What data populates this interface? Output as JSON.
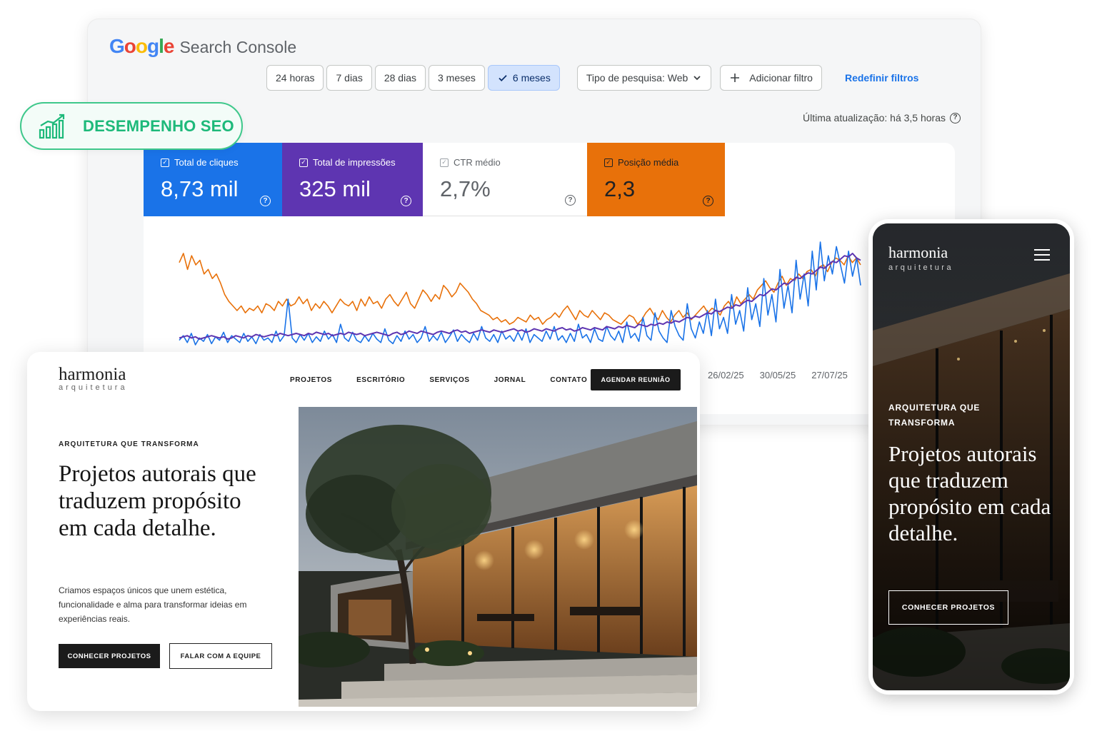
{
  "search_console": {
    "product_name": "Search Console",
    "google_letters": [
      {
        "char": "G",
        "color": "#4285F4"
      },
      {
        "char": "o",
        "color": "#EA4335"
      },
      {
        "char": "o",
        "color": "#FBBC05"
      },
      {
        "char": "g",
        "color": "#4285F4"
      },
      {
        "char": "l",
        "color": "#34A853"
      },
      {
        "char": "e",
        "color": "#EA4335"
      }
    ],
    "date_ranges": [
      "24 horas",
      "7 dias",
      "28 dias",
      "3 meses",
      "6 meses"
    ],
    "selected_range": "6 meses",
    "search_type": "Tipo de pesquisa: Web",
    "add_filter": "Adicionar filtro",
    "reset_filters": "Redefinir filtros",
    "last_update": "Última atualização: há 3,5 horas",
    "metrics": [
      {
        "label": "Total de cliques",
        "value": "8,73 mil",
        "color": "#1a73e8"
      },
      {
        "label": "Total de impressões",
        "value": "325 mil",
        "color": "#5e35b1"
      },
      {
        "label": "CTR médio",
        "value": "2,7%",
        "color": "#ffffff"
      },
      {
        "label": "Posição média",
        "value": "2,3",
        "color": "#e8710a"
      }
    ]
  },
  "chart_data": {
    "type": "line",
    "x_tick_labels": [
      "26/02/25",
      "30/05/25",
      "27/07/25"
    ],
    "grid": false,
    "legend": "none",
    "series": [
      {
        "color": "#e8710a",
        "values": [
          72,
          80,
          66,
          78,
          70,
          74,
          62,
          66,
          58,
          62,
          54,
          44,
          38,
          34,
          30,
          34,
          28,
          32,
          30,
          34,
          28,
          36,
          34,
          30,
          38,
          34,
          40,
          34,
          36,
          42,
          36,
          40,
          30,
          36,
          32,
          38,
          34,
          28,
          34,
          40,
          36,
          34,
          38,
          30,
          40,
          34,
          42,
          36,
          38,
          32,
          40,
          44,
          38,
          34,
          40,
          46,
          36,
          32,
          40,
          48,
          44,
          38,
          44,
          40,
          52,
          48,
          42,
          46,
          54,
          50,
          46,
          40,
          36,
          30,
          28,
          26,
          22,
          24,
          20,
          22,
          18,
          20,
          24,
          22,
          20,
          26,
          22,
          24,
          18,
          22,
          24,
          28,
          24,
          30,
          34,
          28,
          22,
          30,
          26,
          24,
          30,
          26,
          22,
          28,
          26,
          22,
          20,
          18,
          22,
          26,
          24,
          18,
          22,
          28,
          32,
          26,
          22,
          30,
          24,
          20,
          26,
          30,
          24,
          28,
          22,
          26,
          30,
          34,
          28,
          32,
          30,
          26,
          34,
          38,
          32,
          42,
          36,
          40,
          44,
          40,
          48,
          52,
          56,
          50,
          46,
          54,
          60,
          52,
          58,
          56,
          62,
          58,
          64,
          66,
          60,
          68,
          70,
          64,
          72,
          76,
          74,
          70,
          78,
          72,
          76,
          70
        ]
      },
      {
        "color": "#1a73e8",
        "values": [
          4,
          8,
          2,
          10,
          0,
          6,
          3,
          9,
          1,
          7,
          4,
          11,
          2,
          8,
          5,
          2,
          10,
          3,
          7,
          1,
          9,
          4,
          6,
          2,
          12,
          3,
          8,
          40,
          6,
          2,
          9,
          4,
          10,
          2,
          7,
          3,
          12,
          5,
          9,
          2,
          18,
          6,
          3,
          11,
          4,
          2,
          8,
          3,
          10,
          5,
          2,
          14,
          4,
          1,
          8,
          3,
          12,
          5,
          9,
          2,
          6,
          16,
          3,
          8,
          4,
          11,
          2,
          7,
          13,
          3,
          9,
          5,
          2,
          10,
          4,
          16,
          6,
          3,
          9,
          2,
          12,
          5,
          8,
          3,
          11,
          4,
          14,
          2,
          9,
          6,
          3,
          12,
          5,
          16,
          4,
          8,
          2,
          10,
          3,
          18,
          6,
          9,
          2,
          14,
          5,
          3,
          16,
          8,
          4,
          12,
          2,
          20,
          6,
          10,
          3,
          24,
          8,
          4,
          28,
          12,
          6,
          2,
          30,
          16,
          8,
          4,
          36,
          14,
          6,
          20,
          10,
          30,
          8,
          40,
          14,
          24,
          10,
          44,
          18,
          30,
          12,
          50,
          22,
          36,
          16,
          58,
          26,
          44,
          20,
          66,
          32,
          52,
          28,
          74,
          40,
          62,
          34,
          82,
          48,
          90,
          56,
          78,
          62,
          86,
          70,
          54,
          82,
          60,
          76,
          52
        ]
      },
      {
        "color": "#5e35b1",
        "values": [
          6,
          7,
          8,
          6,
          7,
          5,
          6,
          7,
          8,
          7,
          6,
          7,
          5,
          6,
          8,
          7,
          6,
          8,
          7,
          9,
          8,
          7,
          8,
          9,
          8,
          10,
          9,
          8,
          9,
          10,
          9,
          8,
          10,
          9,
          11,
          10,
          9,
          10,
          8,
          9,
          10,
          9,
          11,
          10,
          9,
          10,
          8,
          9,
          10,
          11,
          10,
          9,
          8,
          10,
          11,
          9,
          10,
          12,
          11,
          10,
          12,
          11,
          10,
          9,
          11,
          12,
          11,
          10,
          12,
          13,
          11,
          12,
          10,
          11,
          12,
          13,
          12,
          11,
          13,
          12,
          11,
          12,
          13,
          14,
          12,
          13,
          11,
          12,
          14,
          13,
          12,
          14,
          13,
          12,
          14,
          15,
          13,
          14,
          12,
          13,
          15,
          14,
          13,
          15,
          14,
          13,
          16,
          15,
          14,
          16,
          15,
          17,
          16,
          15,
          18,
          17,
          16,
          18,
          17,
          19,
          18,
          20,
          19,
          21,
          20,
          22,
          24,
          23,
          25,
          24,
          26,
          28,
          27,
          30,
          29,
          31,
          33,
          32,
          35,
          34,
          37,
          39,
          38,
          41,
          44,
          43,
          46,
          49,
          48,
          51,
          54,
          53,
          56,
          59,
          58,
          61,
          63,
          62,
          65,
          68,
          67,
          70,
          73,
          72,
          75,
          78,
          77,
          80,
          76,
          74
        ]
      }
    ]
  },
  "seo_badge": {
    "label": "DESEMPENHO SEO",
    "color": "#1db97a"
  },
  "desktop_site": {
    "brand_name": "harmonia",
    "brand_sub": "arquitetura",
    "nav": [
      "PROJETOS",
      "ESCRITÓRIO",
      "SERVIÇOS",
      "JORNAL",
      "CONTATO"
    ],
    "cta": "AGENDAR REUNIÃO",
    "kicker": "ARQUITETURA QUE TRANSFORMA",
    "title": "Projetos autorais que traduzem propósito em cada detalhe.",
    "text": "Criamos espaços únicos que unem estética, funcionalidade e alma para transformar ideias em experiências reais.",
    "primary_button": "CONHECER PROJETOS",
    "secondary_button": "FALAR COM A EQUIPE"
  },
  "mobile_site": {
    "brand_name": "harmonia",
    "brand_sub": "arquitetura",
    "kicker": "ARQUITETURA QUE TRANSFORMA",
    "title": "Projetos autorais que traduzem propósito em cada detalhe.",
    "button": "CONHECER PROJETOS"
  },
  "icons": [
    "check-icon",
    "chevron-down-icon",
    "plus-icon",
    "help-circle-icon",
    "checkbox-icon",
    "growth-chart-icon",
    "hamburger-menu-icon"
  ]
}
